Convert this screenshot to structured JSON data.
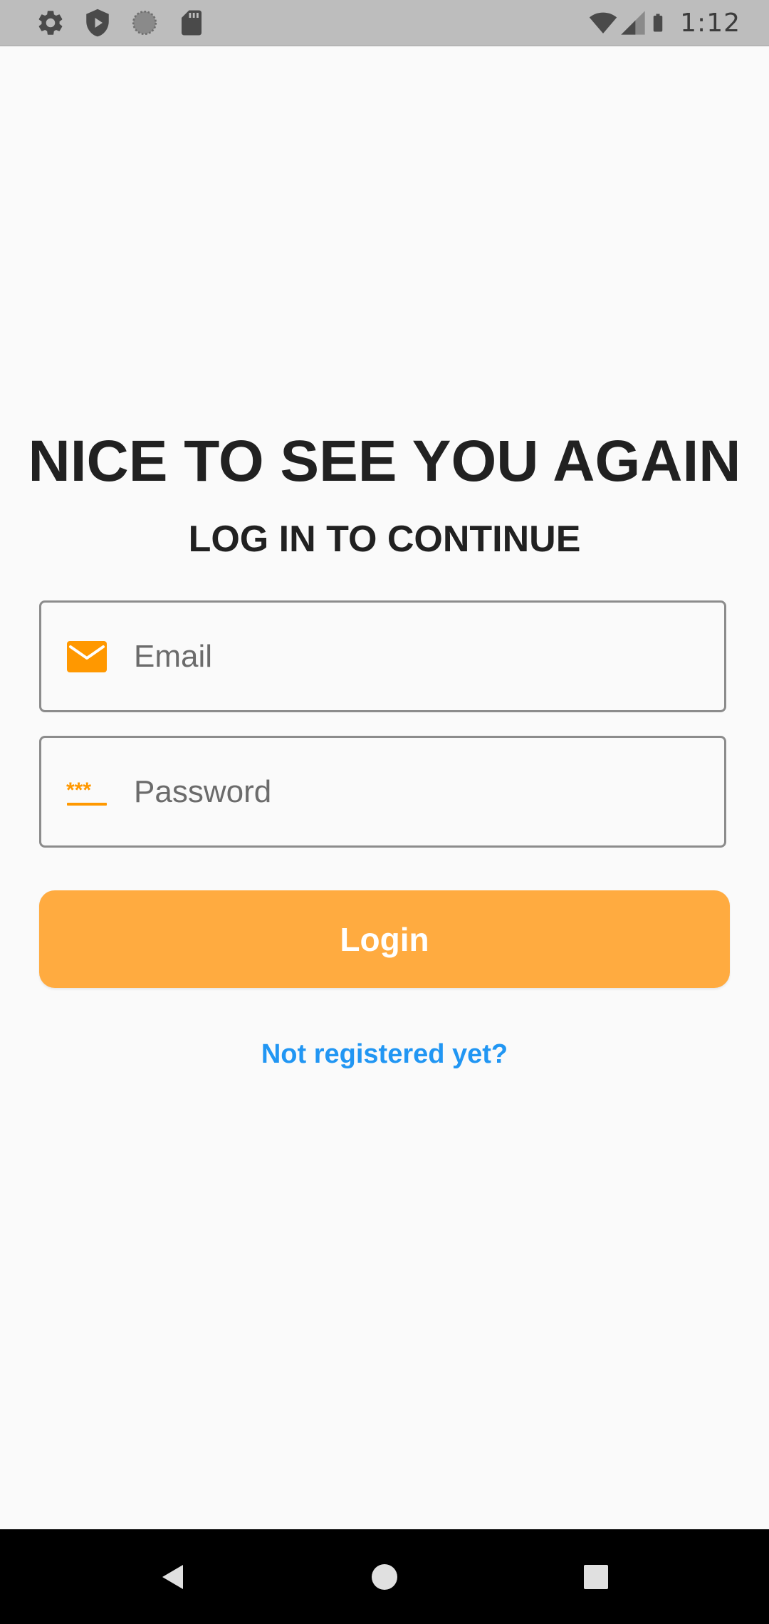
{
  "status_bar": {
    "time": "1:12",
    "left_icons": [
      "gear-icon",
      "shield-play-icon",
      "loading-circle-icon",
      "sd-card-icon"
    ],
    "right_icons": [
      "wifi-icon",
      "cellular-signal-icon",
      "battery-icon"
    ]
  },
  "login": {
    "headline": "NICE TO SEE YOU AGAIN",
    "subheadline": "LOG IN TO CONTINUE",
    "email": {
      "placeholder": "Email",
      "value": "",
      "icon": "mail-icon"
    },
    "password": {
      "placeholder": "Password",
      "value": "",
      "icon": "password-asterisks-icon"
    },
    "login_button_label": "Login",
    "register_link_label": "Not registered yet?"
  },
  "nav_bar": {
    "buttons": [
      "back-icon",
      "home-icon",
      "recents-icon"
    ]
  },
  "colors": {
    "accent": "#FFAB40",
    "icon_orange": "#FF9800",
    "link": "#2196F3",
    "text_dark": "#212121",
    "background": "#FAFAFA",
    "status_bar": "#BDBDBD",
    "nav_bar": "#000000"
  }
}
